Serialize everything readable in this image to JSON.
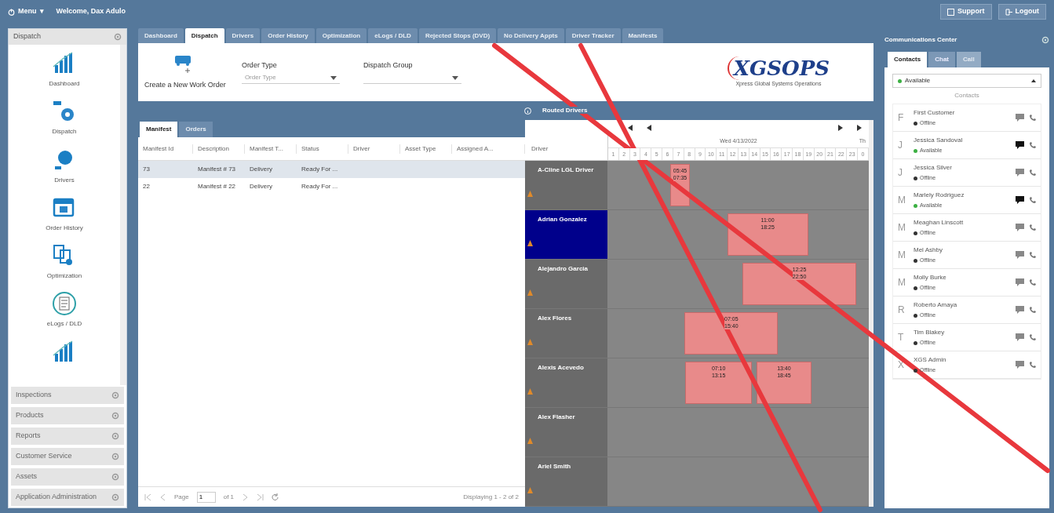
{
  "topbar": {
    "menu": "Menu",
    "menu_caret": "▾",
    "welcome": "Welcome, Dax Adulo",
    "buttons": [
      {
        "label": "Support",
        "kind": "support"
      },
      {
        "label": "Logout",
        "kind": "logout"
      }
    ]
  },
  "sidebar": {
    "title": "Dispatch",
    "items": [
      {
        "label": "Dashboard",
        "kind": "chart"
      },
      {
        "label": "Dispatch",
        "kind": "dispatch"
      },
      {
        "label": "Drivers",
        "kind": "driver"
      },
      {
        "label": "Order History",
        "kind": "calendar"
      },
      {
        "label": "Optimization",
        "kind": "docs"
      },
      {
        "label": "eLogs / DLD",
        "kind": "log"
      },
      {
        "kind": "chart"
      }
    ],
    "sections": [
      "Inspections",
      "Products",
      "Reports",
      "Customer Service",
      "Assets",
      "Application Administration"
    ]
  },
  "tabs": [
    {
      "label": "Dashboard",
      "selected": false
    },
    {
      "label": "Dispatch",
      "selected": true
    },
    {
      "label": "Drivers",
      "selected": false
    },
    {
      "label": "Order History",
      "selected": false
    },
    {
      "label": "Optimization",
      "selected": false
    },
    {
      "label": "eLogs / DLD",
      "selected": false
    },
    {
      "label": "Rejected Stops (DVD)",
      "selected": false
    },
    {
      "label": "No Delivery Appts",
      "selected": false
    },
    {
      "label": "Driver Tracker",
      "selected": false
    },
    {
      "label": "Manifests",
      "selected": false
    }
  ],
  "toolbar": {
    "create_label": "Create a New Work Order",
    "filters": [
      {
        "label": "Order Type",
        "placeholder": "Order Type"
      },
      {
        "label": "Dispatch Group"
      }
    ],
    "logo": "XGSOPS",
    "logo_tagline": "Xpress Global Systems Operations"
  },
  "routed_drivers_title": "Routed Drivers",
  "grid": {
    "tabs": [
      {
        "label": "Manifest",
        "selected": true
      },
      {
        "label": "Orders",
        "selected": false
      }
    ],
    "columns": [
      "Manifest Id",
      "Description",
      "Manifest T...",
      "Status",
      "Driver",
      "Asset Type",
      "Assigned A..."
    ],
    "rows": [
      {
        "cells": [
          "73",
          "Manifest # 73",
          "Delivery",
          "Ready For ...",
          "",
          "",
          ""
        ],
        "selected": true
      },
      {
        "cells": [
          "22",
          "Manifest # 22",
          "Delivery",
          "Ready For ...",
          "",
          "",
          ""
        ],
        "selected": false
      }
    ],
    "pager": {
      "page_label": "Page",
      "page": "1",
      "of": "of 1",
      "summary": "Displaying 1 - 2 of 2"
    }
  },
  "schedule": {
    "driver_header": "Driver",
    "date": "Wed 4/13/2022",
    "next_date": "Th",
    "hours": [
      "1",
      "2",
      "3",
      "4",
      "5",
      "6",
      "7",
      "8",
      "9",
      "10",
      "11",
      "12",
      "13",
      "14",
      "15",
      "16",
      "17",
      "18",
      "19",
      "20",
      "21",
      "22",
      "23",
      "0"
    ],
    "drivers": [
      {
        "name": "A-Cline LGL Driver",
        "selected": false,
        "routes": [
          {
            "start": "05:45",
            "end": "07:35"
          }
        ]
      },
      {
        "name": "Adrian Gonzalez",
        "selected": true,
        "routes": [
          {
            "start": "11:00",
            "end": "18:25"
          }
        ]
      },
      {
        "name": "Alejandro Garcia",
        "selected": false,
        "routes": [
          {
            "start": "12:25",
            "end": "22:50"
          }
        ]
      },
      {
        "name": "Alex Flores",
        "selected": false,
        "routes": [
          {
            "start": "07:05",
            "end": "15:40"
          }
        ]
      },
      {
        "name": "Alexis Acevedo",
        "selected": false,
        "routes": [
          {
            "start": "07:10",
            "end": "13:15"
          },
          {
            "start": "13:40",
            "end": "18:45"
          }
        ]
      },
      {
        "name": "Alex Flasher",
        "selected": false
      },
      {
        "name": "Ariel Smith",
        "selected": false
      }
    ]
  },
  "comm": {
    "title": "Communications Center",
    "tabs": [
      {
        "label": "Contacts",
        "selected": true,
        "disabled": false
      },
      {
        "label": "Chat",
        "selected": false,
        "disabled": false
      },
      {
        "label": "Call",
        "selected": false,
        "disabled": true
      }
    ],
    "status": {
      "label": "Available",
      "color": "#3cb043"
    },
    "list_title": "Contacts",
    "contacts": [
      {
        "initial": "F",
        "name": "First Customer",
        "status": "Offline",
        "color": "#333333"
      },
      {
        "initial": "J",
        "name": "Jessica Sandoval",
        "status": "Available",
        "color": "#3cb043"
      },
      {
        "initial": "J",
        "name": "Jessica Silver",
        "status": "Offline",
        "color": "#333333"
      },
      {
        "initial": "M",
        "name": "Marlely Rodriguez",
        "status": "Available",
        "color": "#3cb043"
      },
      {
        "initial": "M",
        "name": "Meaghan Linscott",
        "status": "Offline",
        "color": "#333333"
      },
      {
        "initial": "M",
        "name": "Mel Ashby",
        "status": "Offline",
        "color": "#333333"
      },
      {
        "initial": "M",
        "name": "Molly Burke",
        "status": "Offline",
        "color": "#333333"
      },
      {
        "initial": "R",
        "name": "Roberto Amaya",
        "status": "Offline",
        "color": "#333333"
      },
      {
        "initial": "T",
        "name": "Tim Blakey",
        "status": "Offline",
        "color": "#333333"
      },
      {
        "initial": "X",
        "name": "XGS Admin",
        "status": "Offline",
        "color": "#333333"
      }
    ]
  },
  "crossed_out": true
}
